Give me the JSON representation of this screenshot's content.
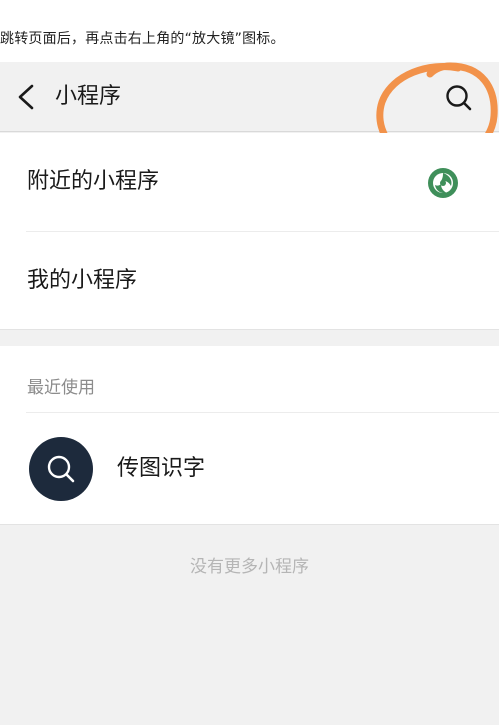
{
  "instruction_text": "跳转页面后，再点击右上角的“放大镜”图标。",
  "navbar": {
    "title": "小程序",
    "back_icon": "chevron-left-icon",
    "search_icon": "search-icon",
    "highlight_color": "#f2924a"
  },
  "menu": {
    "nearby_label": "附近的小程序",
    "nearby_icon": "nearby-mini-program-icon",
    "mine_label": "我的小程序"
  },
  "recent": {
    "header": "最近使用",
    "apps": [
      {
        "name": "传图识字",
        "icon": "search-icon",
        "icon_bg": "#1d2a3c"
      }
    ]
  },
  "footer_note": "没有更多小程序"
}
